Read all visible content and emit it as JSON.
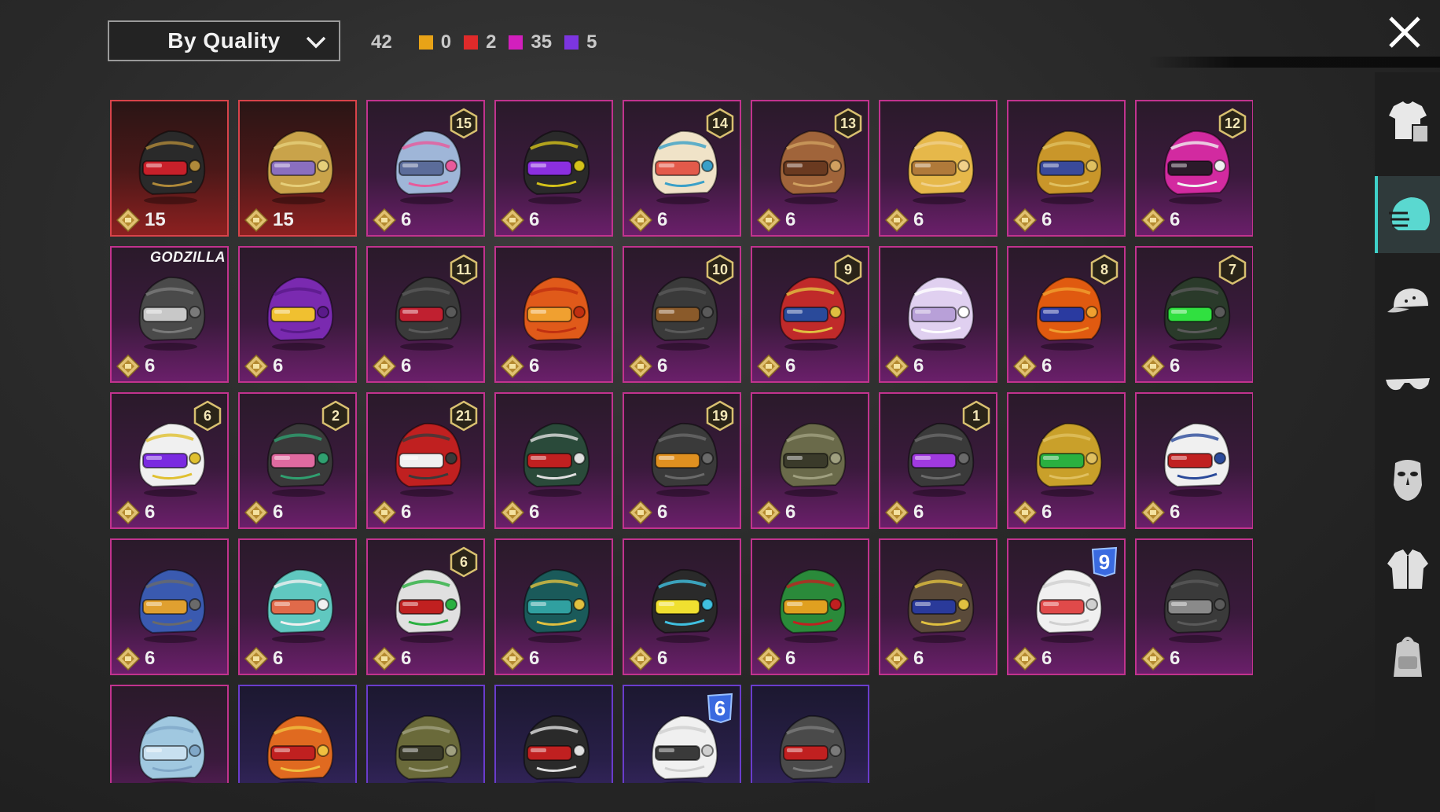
{
  "sort": {
    "label": "By Quality",
    "icon": "chevron-down-icon"
  },
  "summary": {
    "total": "42",
    "counts": [
      {
        "color": "#e8a317",
        "value": "0"
      },
      {
        "color": "#e02a2a",
        "value": "2"
      },
      {
        "color": "#d21fbd",
        "value": "35"
      },
      {
        "color": "#7c35e0",
        "value": "5"
      }
    ]
  },
  "close_icon": "close-icon",
  "colors": {
    "mythic_border": "#c1338e",
    "legendary_border": "#d8434a",
    "epic_border": "#6a3ccc",
    "sidebar_active": "#3fd0c8"
  },
  "items": [
    {
      "tier": "legendary",
      "price": "15",
      "badge": "",
      "colors": [
        "#2a2a2a",
        "#c8202a",
        "#b08a3a"
      ]
    },
    {
      "tier": "legendary",
      "price": "15",
      "badge": "",
      "colors": [
        "#c9a34a",
        "#8a6fbf",
        "#e6cf7a"
      ]
    },
    {
      "tier": "mythic",
      "price": "6",
      "badge": "15",
      "colors": [
        "#9fb6d8",
        "#5b6c9a",
        "#e85a9b"
      ]
    },
    {
      "tier": "mythic",
      "price": "6",
      "badge": "",
      "colors": [
        "#2a2a2a",
        "#8b2fe0",
        "#d4c21a"
      ]
    },
    {
      "tier": "mythic",
      "price": "6",
      "badge": "14",
      "colors": [
        "#f0e3c8",
        "#e35a4a",
        "#3aa0c8"
      ]
    },
    {
      "tier": "mythic",
      "price": "6",
      "badge": "13",
      "colors": [
        "#a0643a",
        "#6a3a20",
        "#d0a060"
      ]
    },
    {
      "tier": "mythic",
      "price": "6",
      "badge": "",
      "colors": [
        "#e6b84a",
        "#b07a3a",
        "#f0d08a"
      ]
    },
    {
      "tier": "mythic",
      "price": "6",
      "badge": "",
      "colors": [
        "#c9962a",
        "#3a4a9a",
        "#e0c060"
      ]
    },
    {
      "tier": "mythic",
      "price": "6",
      "badge": "12",
      "colors": [
        "#d22aa0",
        "#2a1a2a",
        "#f0f0f0"
      ]
    },
    {
      "tier": "mythic",
      "price": "6",
      "badge": "",
      "special": "GODZILLA",
      "colors": [
        "#4a4a4a",
        "#c8c8c8",
        "#7a7a7a"
      ]
    },
    {
      "tier": "mythic",
      "price": "6",
      "badge": "",
      "colors": [
        "#7a2ab0",
        "#f0c030",
        "#5a1a8a"
      ]
    },
    {
      "tier": "mythic",
      "price": "6",
      "badge": "11",
      "colors": [
        "#3a3a3a",
        "#c02030",
        "#5a5a5a"
      ]
    },
    {
      "tier": "mythic",
      "price": "6",
      "badge": "",
      "colors": [
        "#e05a1a",
        "#f0a030",
        "#c03010"
      ]
    },
    {
      "tier": "mythic",
      "price": "6",
      "badge": "10",
      "colors": [
        "#3a3a3a",
        "#8a5a2a",
        "#5a5a5a"
      ]
    },
    {
      "tier": "mythic",
      "price": "6",
      "badge": "9",
      "colors": [
        "#c02a2a",
        "#2a4a9a",
        "#e0c040"
      ]
    },
    {
      "tier": "mythic",
      "price": "6",
      "badge": "",
      "colors": [
        "#e0d0f0",
        "#b8a0d8",
        "#ffffff"
      ]
    },
    {
      "tier": "mythic",
      "price": "6",
      "badge": "8",
      "colors": [
        "#e05a10",
        "#2a3aa0",
        "#f0a030"
      ]
    },
    {
      "tier": "mythic",
      "price": "6",
      "badge": "7",
      "colors": [
        "#2a3a2a",
        "#30e040",
        "#5a5a5a"
      ]
    },
    {
      "tier": "mythic",
      "price": "6",
      "badge": "6",
      "colors": [
        "#f0f0f0",
        "#7a2ae0",
        "#e0c030"
      ]
    },
    {
      "tier": "mythic",
      "price": "6",
      "badge": "2",
      "colors": [
        "#3a3a3a",
        "#e06aa0",
        "#30a070"
      ]
    },
    {
      "tier": "mythic",
      "price": "6",
      "badge": "21",
      "colors": [
        "#c02020",
        "#f0f0f0",
        "#3a3a3a"
      ]
    },
    {
      "tier": "mythic",
      "price": "6",
      "badge": "",
      "colors": [
        "#2a4a3a",
        "#c02020",
        "#e0e0e0"
      ]
    },
    {
      "tier": "mythic",
      "price": "6",
      "badge": "19",
      "colors": [
        "#3a3a3a",
        "#e09020",
        "#6a6a6a"
      ]
    },
    {
      "tier": "mythic",
      "price": "6",
      "badge": "",
      "colors": [
        "#6a6a4a",
        "#3a3a2a",
        "#a0a080"
      ]
    },
    {
      "tier": "mythic",
      "price": "6",
      "badge": "1",
      "colors": [
        "#3a3a3a",
        "#a03ae0",
        "#6a6a6a"
      ]
    },
    {
      "tier": "mythic",
      "price": "6",
      "badge": "",
      "colors": [
        "#c9a02a",
        "#2ab040",
        "#e0c060"
      ]
    },
    {
      "tier": "mythic",
      "price": "6",
      "badge": "",
      "colors": [
        "#f0f0f0",
        "#c02020",
        "#2a4a9a"
      ]
    },
    {
      "tier": "mythic",
      "price": "6",
      "badge": "",
      "colors": [
        "#3a5ab0",
        "#e0a030",
        "#6a6a6a"
      ]
    },
    {
      "tier": "mythic",
      "price": "6",
      "badge": "",
      "colors": [
        "#60c8c0",
        "#e06a4a",
        "#f0f0f0"
      ]
    },
    {
      "tier": "mythic",
      "price": "6",
      "badge": "6",
      "colors": [
        "#e0e0e0",
        "#c02020",
        "#2ab040"
      ]
    },
    {
      "tier": "mythic",
      "price": "6",
      "badge": "",
      "colors": [
        "#1a5a5a",
        "#30a0a0",
        "#e0c040"
      ]
    },
    {
      "tier": "mythic",
      "price": "6",
      "badge": "",
      "colors": [
        "#2a2a2a",
        "#f0e030",
        "#40c0e0"
      ]
    },
    {
      "tier": "mythic",
      "price": "6",
      "badge": "",
      "colors": [
        "#2a8a3a",
        "#e0a020",
        "#c02020"
      ]
    },
    {
      "tier": "mythic",
      "price": "6",
      "badge": "",
      "colors": [
        "#5a4a3a",
        "#2a3a9a",
        "#e0c040"
      ]
    },
    {
      "tier": "mythic",
      "price": "6",
      "badge": "9",
      "badge_style": "blue",
      "colors": [
        "#f0f0f0",
        "#e04a4a",
        "#d0d0d0"
      ]
    },
    {
      "tier": "mythic",
      "price": "6",
      "badge": "",
      "colors": [
        "#3a3a3a",
        "#8a8a8a",
        "#5a5a5a"
      ]
    },
    {
      "tier": "mythic",
      "price": "",
      "badge": "",
      "colors": [
        "#a0c8e0",
        "#c8e0f0",
        "#80a8c8"
      ]
    },
    {
      "tier": "epic",
      "price": "",
      "badge": "",
      "colors": [
        "#e06a20",
        "#c02020",
        "#f0c040"
      ]
    },
    {
      "tier": "epic",
      "price": "",
      "badge": "",
      "colors": [
        "#6a6a3a",
        "#3a3a2a",
        "#a0a080"
      ]
    },
    {
      "tier": "epic",
      "price": "",
      "badge": "",
      "colors": [
        "#2a2a2a",
        "#c02020",
        "#e0e0e0"
      ]
    },
    {
      "tier": "epic",
      "price": "",
      "badge": "6",
      "badge_style": "blue",
      "colors": [
        "#f0f0f0",
        "#3a3a3a",
        "#d0d0d0"
      ]
    },
    {
      "tier": "epic",
      "price": "",
      "badge": "",
      "colors": [
        "#4a4a4a",
        "#c02020",
        "#7a7a7a"
      ]
    }
  ],
  "sidebar": [
    {
      "name": "outfit-icon",
      "active": false
    },
    {
      "name": "helmet-icon",
      "active": true
    },
    {
      "name": "cap-icon",
      "active": false
    },
    {
      "name": "glasses-icon",
      "active": false
    },
    {
      "name": "mask-icon",
      "active": false
    },
    {
      "name": "jacket-icon",
      "active": false
    },
    {
      "name": "backpack-icon",
      "active": false
    }
  ]
}
